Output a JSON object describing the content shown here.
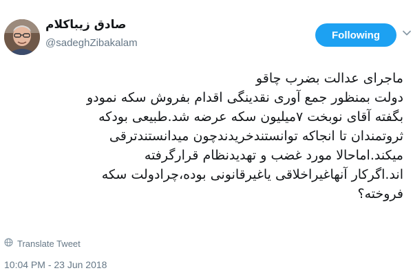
{
  "author": {
    "display_name": "صادق زیباکلام",
    "handle": "@sadeghZibakalam"
  },
  "follow_button": {
    "label": "Following",
    "color": "#1da1f2"
  },
  "tweet": {
    "lines": [
      "ماجرای عدالت بضرب چاقو",
      "دولت بمنظور جمع آوری نقدینگی اقدام بفروش سکه نمودو",
      "بگفته آقای نوبخت ۷میلیون سکه عرضه شد.طبیعی بودکه",
      "ثروتمندان تا انجاکه توانستندخریدندچون میدانستندترقی",
      "میکند.اماحالا مورد غضب و تهدیدنظام قرارگرفته",
      "اند.اگرکار آنهاغیراخلاقی یاغیرقانونی بوده،چرادولت سکه",
      "فروخته؟"
    ]
  },
  "translate_label": "Translate Tweet",
  "timestamp": "10:04 PM - 23 Jun 2018",
  "icons": {
    "avatar": "avatar-photo",
    "caret": "chevron-down-icon",
    "translate": "globe-icon"
  }
}
